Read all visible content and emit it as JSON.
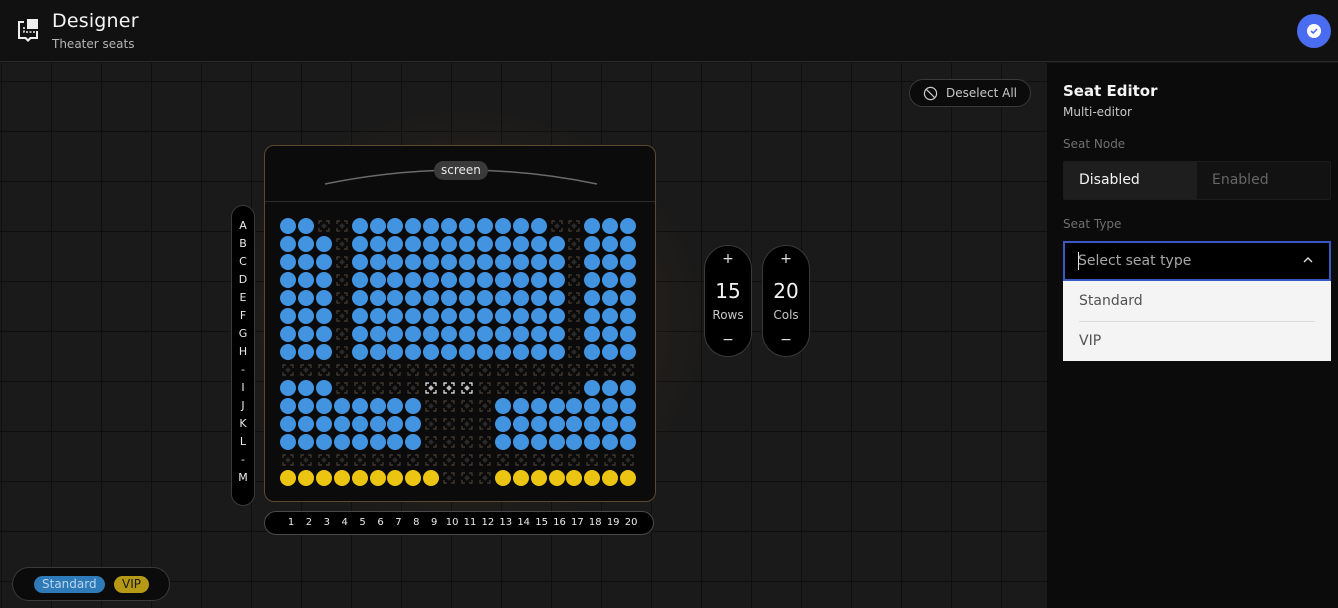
{
  "header": {
    "title": "Designer",
    "subtitle": "Theater seats",
    "logo_icon": "seat-layout-icon",
    "avatar_icon": "check-circle-icon",
    "avatar_color": "#4a6cf0"
  },
  "canvas": {
    "deselect_label": "Deselect All",
    "deselect_icon": "prohibited-icon",
    "screen_label": "screen",
    "row_labels": [
      "A",
      "B",
      "C",
      "D",
      "E",
      "F",
      "G",
      "H",
      "-",
      "I",
      "J",
      "K",
      "L",
      "-",
      "M"
    ],
    "col_labels": [
      "1",
      "2",
      "3",
      "4",
      "5",
      "6",
      "7",
      "8",
      "9",
      "10",
      "11",
      "12",
      "13",
      "14",
      "15",
      "16",
      "17",
      "18",
      "19",
      "20"
    ],
    "seat_colors": {
      "standard": "#4293e0",
      "vip": "#ecc512"
    },
    "seat_map_legend": "S = standard, V = VIP, . = disabled, x = selected disabled",
    "seat_map": [
      "SS..SSSSSSSSSSS..SS",
      "SSS.SSSSSSSSSSSS.SSS",
      "SSS.SSSSSSSSSSSS.SSS",
      "SSS.SSSSSSSSSSSS.SSS",
      "SSS.SSSSSSSSSSSS.SSS",
      "SSS.SSSSSSSSSSSS.SSS",
      "SSS.SSSSSSSSSSSS.SSS",
      "SSS.SSSSSSSSSSSS.SSS",
      "....................",
      "SSS.....xxx......SSS",
      "SSSSSSSS....SSSSSSSS",
      "SSSSSSSS....SSSSSSSS",
      "SSSSSSSS....SSSSSSSS",
      "....................",
      "VVVVVVVVV...VVVVVVVV"
    ],
    "rows_stepper": {
      "value": "15",
      "label": "Rows",
      "plus": "+",
      "minus": "−"
    },
    "cols_stepper": {
      "value": "20",
      "label": "Cols",
      "plus": "+",
      "minus": "−"
    },
    "legend": {
      "standard": "Standard",
      "vip": "VIP"
    }
  },
  "panel": {
    "title": "Seat Editor",
    "subtitle": "Multi-editor",
    "seat_node_label": "Seat Node",
    "seat_node_options": [
      "Disabled",
      "Enabled"
    ],
    "seat_node_selected": "Disabled",
    "seat_type_label": "Seat Type",
    "seat_type_placeholder": "Select seat type",
    "seat_type_value": "",
    "seat_type_options": [
      "Standard",
      "VIP"
    ]
  }
}
